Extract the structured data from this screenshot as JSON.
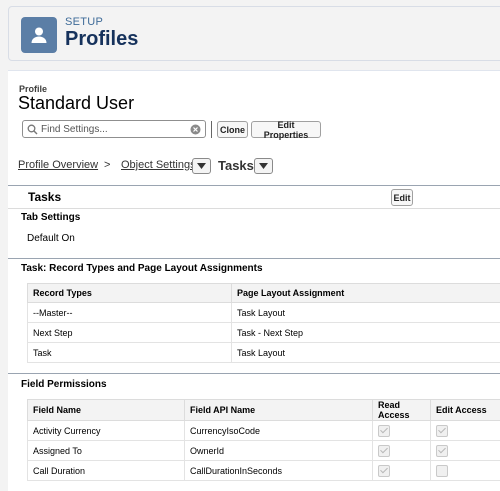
{
  "header": {
    "setup_label": "SETUP",
    "title": "Profiles",
    "icon": "user-icon"
  },
  "profile": {
    "label": "Profile",
    "name": "Standard User"
  },
  "search": {
    "placeholder": "Find Settings..."
  },
  "actions": {
    "clone": "Clone",
    "edit_properties": "Edit Properties"
  },
  "breadcrumb": {
    "overview": "Profile Overview",
    "separator": ">",
    "object_settings": "Object Settings",
    "current": "Tasks"
  },
  "tasks_section": {
    "title": "Tasks",
    "edit_label": "Edit"
  },
  "tab_settings": {
    "title": "Tab Settings",
    "value": "Default On"
  },
  "record_types": {
    "title": "Task: Record Types and Page Layout Assignments",
    "columns": [
      "Record Types",
      "Page Layout Assignment"
    ],
    "rows": [
      [
        "--Master--",
        "Task Layout"
      ],
      [
        "Next Step",
        "Task - Next Step"
      ],
      [
        "Task",
        "Task Layout"
      ]
    ]
  },
  "field_permissions": {
    "title": "Field Permissions",
    "columns": [
      "Field Name",
      "Field API Name",
      "Read Access",
      "Edit Access"
    ],
    "rows": [
      {
        "name": "Activity Currency",
        "api": "CurrencyIsoCode",
        "read": true,
        "edit": true
      },
      {
        "name": "Assigned To",
        "api": "OwnerId",
        "read": true,
        "edit": true
      },
      {
        "name": "Call Duration",
        "api": "CallDurationInSeconds",
        "read": true,
        "edit": false
      }
    ]
  }
}
